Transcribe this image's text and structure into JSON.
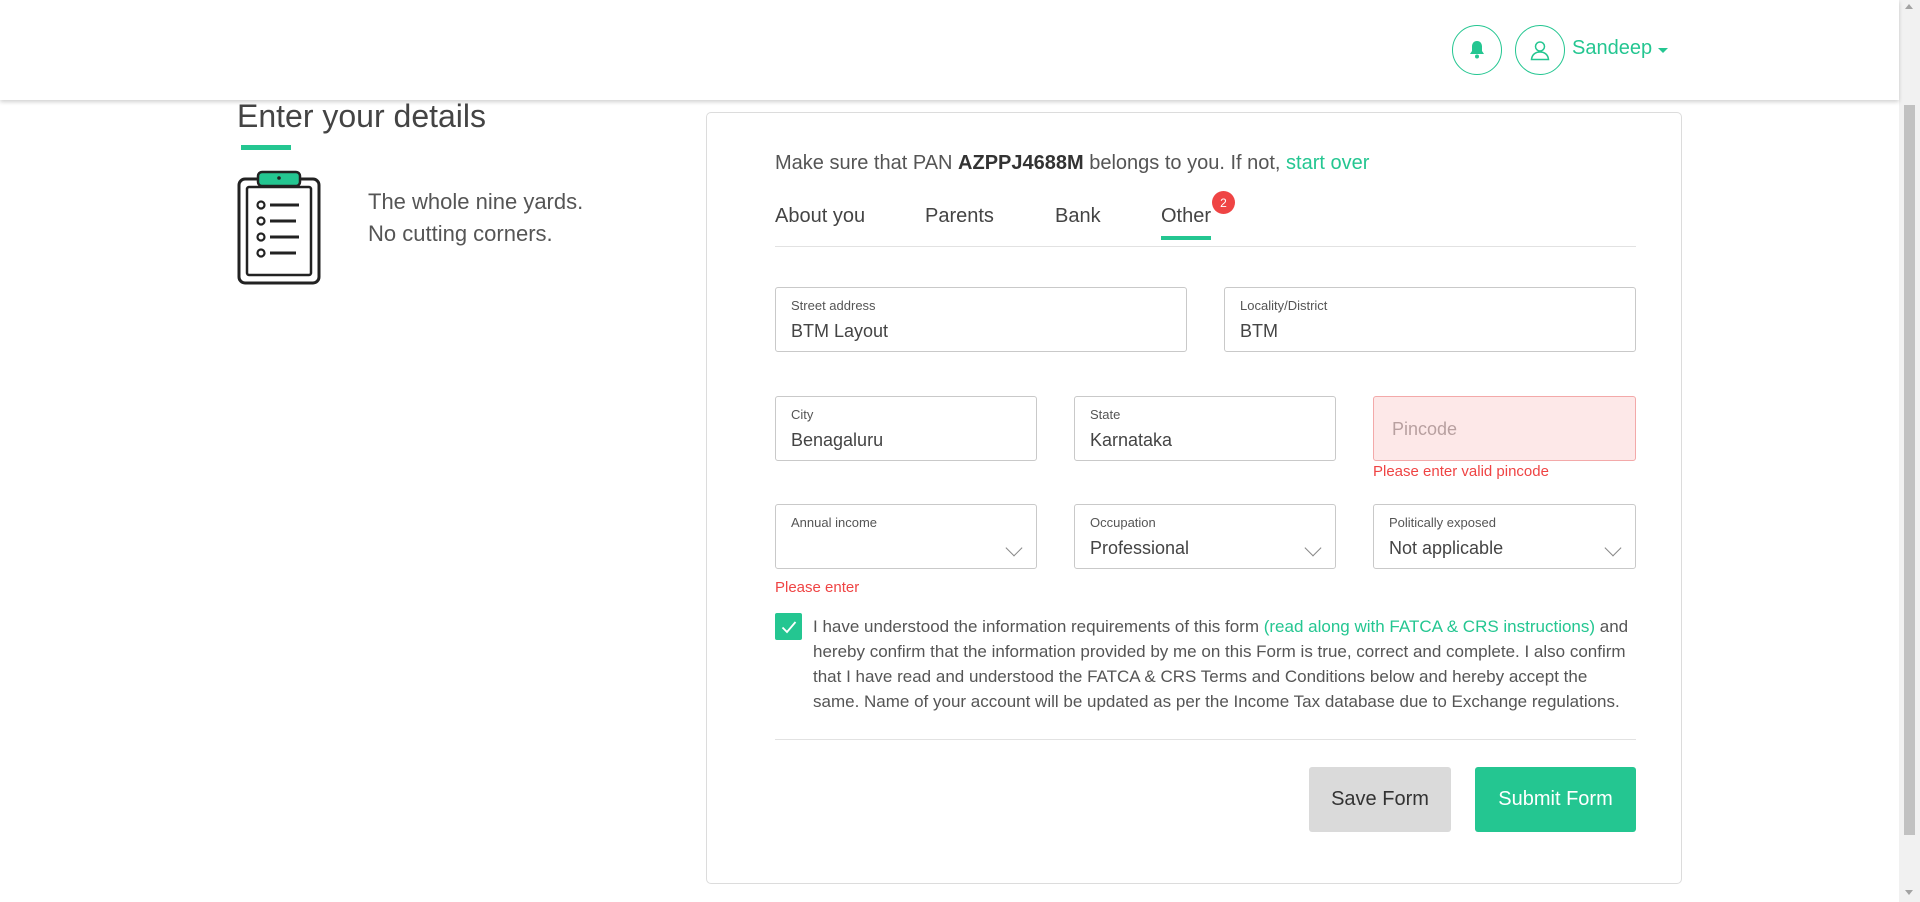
{
  "header": {
    "user_name": "Sandeep",
    "bell_icon": "bell-icon",
    "user_icon": "user-icon"
  },
  "intro": {
    "title": "Enter your details",
    "tagline_line1": "The whole nine yards.",
    "tagline_line2": "No cutting corners."
  },
  "form": {
    "pan_prefix": "Make sure that PAN ",
    "pan_value": "AZPPJ4688M",
    "pan_suffix": " belongs to you. If not, ",
    "start_over": "start over",
    "tabs": [
      {
        "label": "About you"
      },
      {
        "label": "Parents"
      },
      {
        "label": "Bank"
      },
      {
        "label": "Other",
        "active": true,
        "badge": "2"
      }
    ],
    "fields": {
      "street": {
        "label": "Street address",
        "value": "BTM Layout"
      },
      "locality": {
        "label": "Locality/District",
        "value": "BTM"
      },
      "city": {
        "label": "City",
        "value": "Benagaluru"
      },
      "state": {
        "label": "State",
        "value": "Karnataka"
      },
      "pincode": {
        "placeholder": "Pincode",
        "error": "Please enter valid pincode"
      },
      "annual_income": {
        "label": "Annual income",
        "value": "",
        "error": "Please enter"
      },
      "occupation": {
        "label": "Occupation",
        "value": "Professional"
      },
      "politically_exposed": {
        "label": "Politically exposed",
        "value": "Not applicable"
      }
    },
    "consent": {
      "checked": true,
      "text_before": "I have understood the information requirements of this form ",
      "link": "(read along with FATCA & CRS instructions)",
      "text_after": " and hereby confirm that the information provided by me on this Form is true, correct and complete. I also confirm that I have read and understood the FATCA & CRS Terms and Conditions below and hereby accept the same. Name of your account will be updated as per the Income Tax database due to Exchange regulations."
    },
    "buttons": {
      "save": "Save Form",
      "submit": "Submit Form"
    }
  },
  "colors": {
    "accent": "#24c691",
    "error": "#ef4444",
    "error_bg": "#fde8e8"
  }
}
